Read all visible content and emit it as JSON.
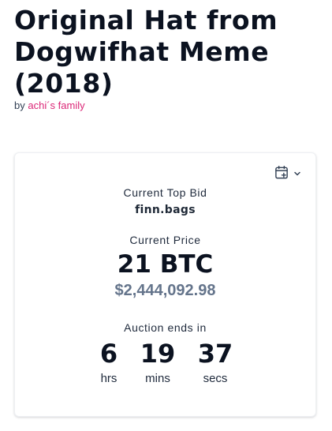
{
  "title": "Original Hat from Dogwifhat Meme (2018)",
  "byline": {
    "prefix": "by",
    "creator": "achi´s family"
  },
  "auction": {
    "calendar_icon": "calendar-add-icon",
    "dropdown_icon": "chevron-down-icon",
    "top_bid_label": "Current Top Bid",
    "top_bidder": "finn.bags",
    "price_label": "Current Price",
    "price": "21 BTC",
    "price_usd": "$2,444,092.98",
    "ends_label": "Auction ends in",
    "countdown": [
      {
        "value": "6",
        "unit": "hrs"
      },
      {
        "value": "19",
        "unit": "mins"
      },
      {
        "value": "37",
        "unit": "secs"
      }
    ]
  },
  "colors": {
    "accent_link": "#db2777",
    "usd_gray": "#64748b",
    "text_dark": "#0b1220"
  }
}
